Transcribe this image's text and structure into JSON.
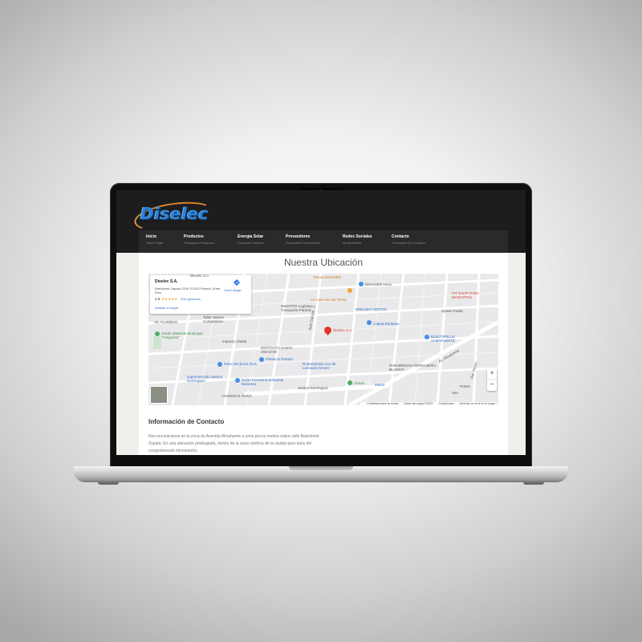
{
  "brand": {
    "logo_text": "Diselec"
  },
  "nav": {
    "items": [
      {
        "label": "Inicio",
        "sub": "Home Page"
      },
      {
        "label": "Productos",
        "sub": "Principales Productos"
      },
      {
        "label": "Energía Solar",
        "sub": "Productos Solares"
      },
      {
        "label": "Proveedores",
        "sub": "Principales Proveedores"
      },
      {
        "label": "Redes Sociales",
        "sub": "Social Media"
      },
      {
        "label": "Contacto",
        "sub": "Formulario De Contacto"
      }
    ]
  },
  "page": {
    "title": "Nuestra Ubicación"
  },
  "map": {
    "card": {
      "name": "Diselec S.A.",
      "address": "Bartolomé Zapata 1206, E3100 Paraná, Entre Ríos",
      "rating": "4.6",
      "stars": "★★★★★",
      "reviews": "206 opiniones",
      "enlarge": "Ampliar el mapa",
      "directions": "Cómo llegar"
    },
    "marker_label": "Diselec S.A",
    "labels": {
      "tienda_wagner": "Tienda WAGNER",
      "envaser": "ENVASER Hoos",
      "fit_shop": "FIT SHOP PARA MASCOTAS",
      "mostito": "MOSTITO Logística y Transporte Paraná",
      "casa_tortas": "La Casa de Las Tortas",
      "krevsky": "KREVSKY MOTOS",
      "splash": "Splash Padel",
      "taller": "Taller Motore Competición",
      "alumino": "EL ALUMINIO",
      "cabral": "Cabral Rodados",
      "electroluz": "ELECTROLUZ ALMAFUERTE",
      "jardin": "Jardín Maternal Municipal \"Amiguitos\"",
      "impacto": "Impacto Global",
      "instituto": "INSTITUTO SANTA ANA D-90",
      "plasticos": "Plásticos Paraná",
      "rodamientos": "Rodamientos Leo de Leonardo Kinner",
      "almafuerte": "Av. Almafuerte",
      "parabrisas": "PARABRISAS-CERRAJERÍA BLANCO",
      "moto_mecanica": "Moto Mecánica Rios",
      "supermercado": "supermercado Santos Dominguez",
      "bulon": "Bulón Ferretería Industrial Bulonera",
      "santos": "Santos Domínguez",
      "armes": "Armes",
      "motos": "Motos",
      "vea": "Vea",
      "puma": "PUMA",
      "hardock": "HARDOCK PAINT",
      "juan_garrigo": "Juan Garrigó",
      "pte_ferreira": "Pte. Perón",
      "diselec_top": "Diselec S.A"
    },
    "zoom_in": "+",
    "zoom_out": "−",
    "attribution": {
      "shortcuts": "Combinaciones de teclas",
      "data": "Datos del mapa ©2023",
      "terms": "Condiciones",
      "report": "Informar un error en el mapa"
    }
  },
  "contact": {
    "title": "Información de Contacto",
    "text": "Nos encontramos en la zona de Avenida Almafuerte a unos pocos metros sobre calle Bartolomé Zapata. En una ubicación privilegiada, dentro de la zona céntrica de la ciudad pero lejos del congestionado microcentro."
  },
  "colors": {
    "header_bg": "#1d1d1d",
    "nav_bg": "#2a2a2a",
    "logo_blue": "#2f84d8",
    "logo_orange": "#d9832a",
    "marker_red": "#e1372b",
    "link_blue": "#2f6cc7"
  },
  "icons": [
    "directions-icon",
    "map-marker-icon",
    "star-rating-icon",
    "zoom-in-icon",
    "zoom-out-icon"
  ]
}
